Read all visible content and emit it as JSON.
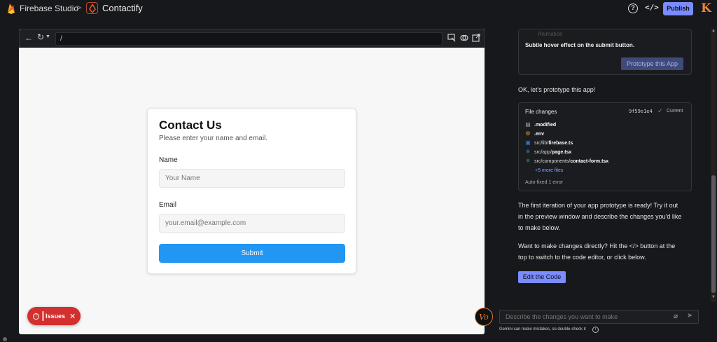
{
  "header": {
    "brand": "Firebase Studio",
    "separator": ">",
    "project": "Contactify",
    "publish_label": "Publish",
    "avatar_letter": "K"
  },
  "preview": {
    "url": "/",
    "form": {
      "title": "Contact Us",
      "subtitle": "Please enter your name and email.",
      "name_label": "Name",
      "name_placeholder": "Your Name",
      "email_label": "Email",
      "email_placeholder": "your.email@example.com",
      "submit_label": "Submit"
    },
    "issues_label": "Issues"
  },
  "chat": {
    "plan_faded": "Animation",
    "plan_text": "Subtle hover effect on the submit button.",
    "prototype_button": "Prototype this App",
    "msg_prototype": "OK, let's prototype this app!",
    "file_changes": {
      "title": "File changes",
      "hash": "9f59e1e4",
      "status": "Current",
      "files": [
        {
          "prefix": "",
          "name": ".modified",
          "icon": "file-icon",
          "color": "#9aa3b5"
        },
        {
          "prefix": "",
          "name": ".env",
          "icon": "settings-file-icon",
          "color": "#e8a33a"
        },
        {
          "prefix": "src/lib/",
          "name": "firebase.ts",
          "icon": "typescript-icon",
          "color": "#3178c6"
        },
        {
          "prefix": "src/app/",
          "name": "page.tsx",
          "icon": "react-icon",
          "color": "#3fb6e8"
        },
        {
          "prefix": "src/components/",
          "name": "contact-form.tsx",
          "icon": "react-icon",
          "color": "#3fb6e8"
        }
      ],
      "more": "+5 more files",
      "auto_fixed": "Auto-fixed 1 error"
    },
    "msg_ready_1": "The first iteration of your app prototype is ready! Try it out",
    "msg_ready_2": "in the preview window and describe the changes you'd like",
    "msg_ready_3": "to make below.",
    "msg_code_1": "Want to make changes directly? Hit the </> button at the",
    "msg_code_2": "top to switch to the code editor, or click below.",
    "edit_button": "Edit the Code",
    "prompt_placeholder": "Describe the changes you want to make",
    "disclaimer": "Gemini can make mistakes, so double-check it"
  },
  "colors": {
    "accent": "#7a8cff",
    "submit": "#2196f3",
    "issues": "#d32f2f",
    "brand_orange": "#e07a2e"
  }
}
